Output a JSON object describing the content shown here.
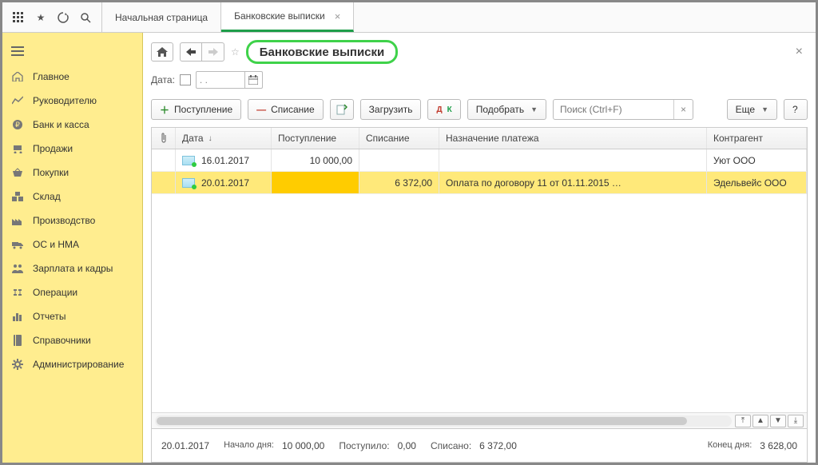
{
  "tabs": [
    {
      "label": "Начальная страница",
      "closable": false
    },
    {
      "label": "Банковские выписки",
      "closable": true
    }
  ],
  "active_tab": 1,
  "sidebar": {
    "items": [
      {
        "label": "Главное",
        "icon": "home"
      },
      {
        "label": "Руководителю",
        "icon": "chart"
      },
      {
        "label": "Банк и касса",
        "icon": "ruble"
      },
      {
        "label": "Продажи",
        "icon": "cart"
      },
      {
        "label": "Покупки",
        "icon": "basket"
      },
      {
        "label": "Склад",
        "icon": "boxes"
      },
      {
        "label": "Производство",
        "icon": "factory"
      },
      {
        "label": "ОС и НМА",
        "icon": "truck"
      },
      {
        "label": "Зарплата и кадры",
        "icon": "people"
      },
      {
        "label": "Операции",
        "icon": "ops"
      },
      {
        "label": "Отчеты",
        "icon": "bars"
      },
      {
        "label": "Справочники",
        "icon": "book"
      },
      {
        "label": "Администрирование",
        "icon": "gear"
      }
    ]
  },
  "page": {
    "title": "Банковские выписки",
    "date_label": "Дата:",
    "date_value": ". .",
    "toolbar": {
      "receipt": "Поступление",
      "writeoff": "Списание",
      "load": "Загрузить",
      "dk": "Дт Кт",
      "pick": "Подобрать",
      "search_placeholder": "Поиск (Ctrl+F)",
      "more": "Еще",
      "help": "?"
    },
    "columns": {
      "clip": "",
      "date": "Дата",
      "in": "Поступление",
      "out": "Списание",
      "purpose": "Назначение платежа",
      "agent": "Контрагент"
    },
    "rows": [
      {
        "date": "16.01.2017",
        "in": "10 000,00",
        "out": "",
        "purpose": "",
        "agent": "Уют ООО",
        "selected": false
      },
      {
        "date": "20.01.2017",
        "in": "",
        "out": "6 372,00",
        "purpose": "Оплата по договору 11 от 01.11.2015 …",
        "agent": "Эдельвейс ООО",
        "selected": true
      }
    ],
    "summary": {
      "date": "20.01.2017",
      "start_label": "Начало дня:",
      "start_value": "10 000,00",
      "in_label": "Поступило:",
      "in_value": "0,00",
      "out_label": "Списано:",
      "out_value": "6 372,00",
      "end_label": "Конец дня:",
      "end_value": "3 628,00"
    }
  }
}
